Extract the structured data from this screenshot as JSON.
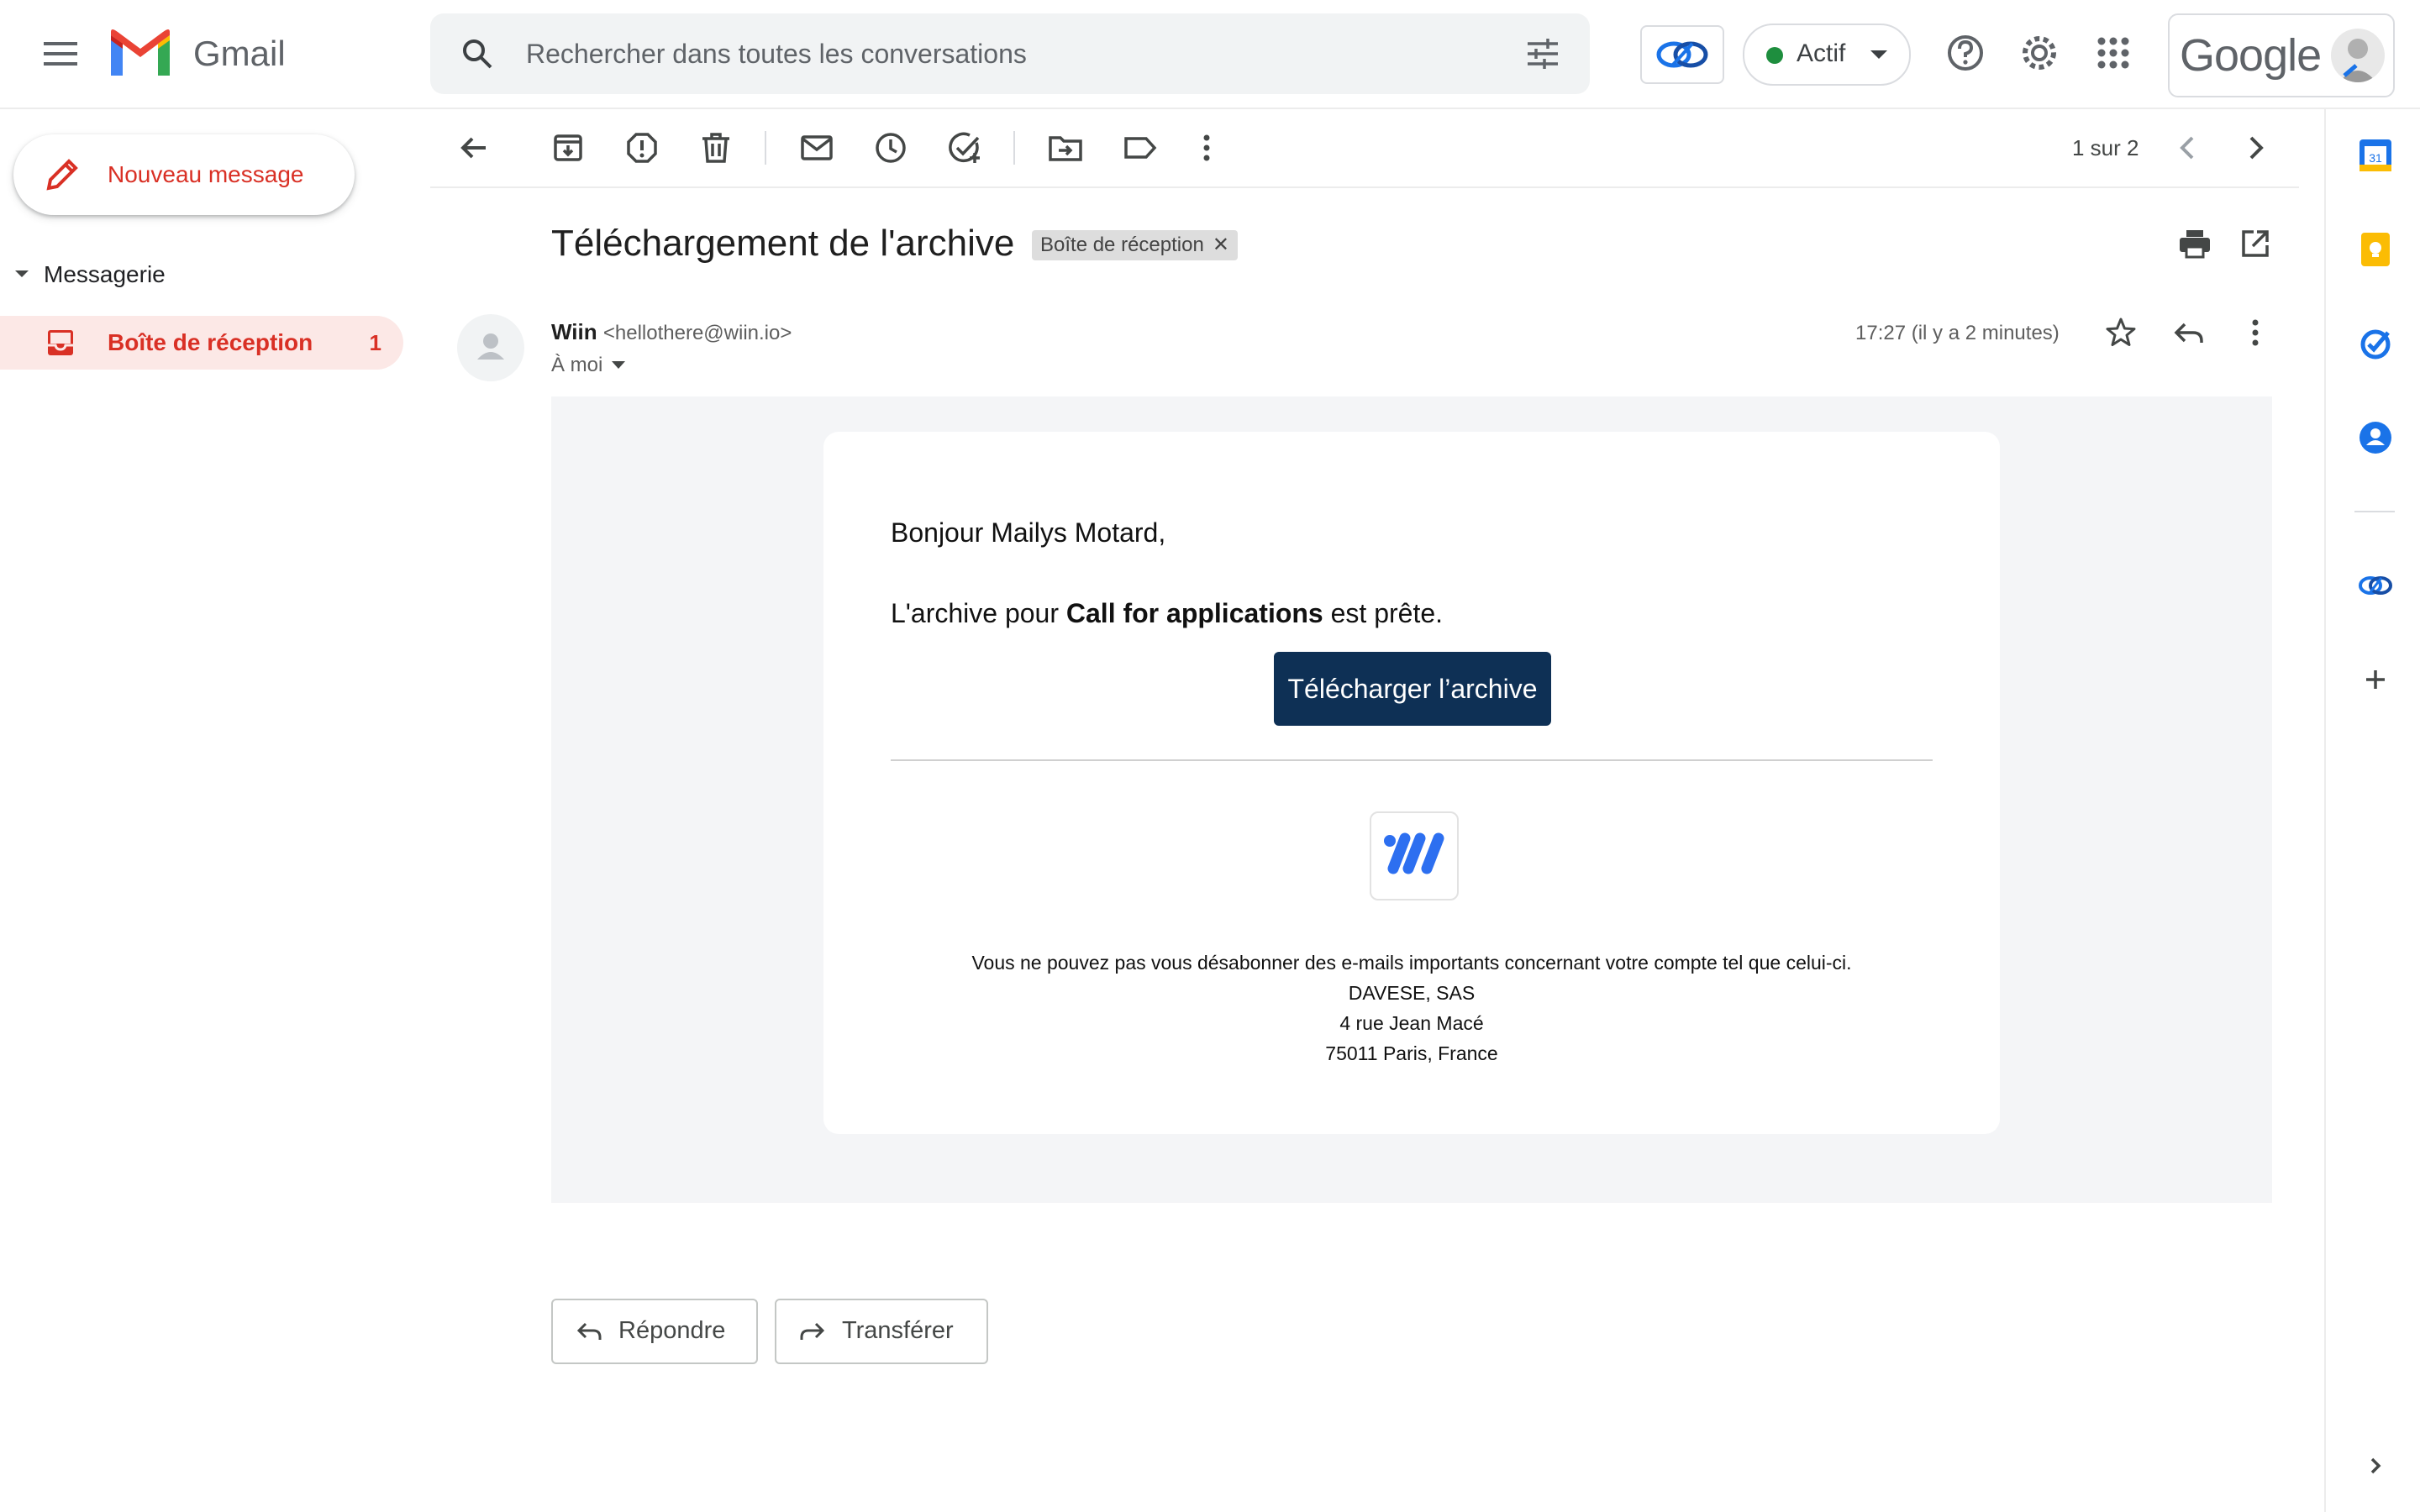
{
  "app": {
    "name": "Gmail",
    "google_label": "Google"
  },
  "search": {
    "placeholder": "Rechercher dans toutes les conversations"
  },
  "status": {
    "label": "Actif",
    "color": "#1e8e3e"
  },
  "compose": {
    "label": "Nouveau message"
  },
  "nav": {
    "section_label": "Messagerie",
    "inbox": {
      "label": "Boîte de réception",
      "count": "1"
    }
  },
  "toolbar": {
    "icons": [
      "back-arrow-icon",
      "archive-icon",
      "report-spam-icon",
      "delete-icon",
      "mark-unread-icon",
      "snooze-icon",
      "add-to-tasks-icon",
      "move-to-icon",
      "label-icon",
      "more-vert-icon"
    ],
    "pager": "1 sur 2"
  },
  "message": {
    "subject": "Téléchargement de l'archive",
    "label_chip": "Boîte de réception",
    "sender_name": "Wiin",
    "sender_email": "<hellothere@wiin.io>",
    "recipient": "À moi",
    "time": "17:27 (il y a 2 minutes)"
  },
  "email_body": {
    "greeting": "Bonjour Mailys Motard,",
    "line_prefix": "L'archive pour ",
    "line_bold": "Call for applications",
    "line_suffix": " est prête.",
    "cta_label": "Télécharger l’archive",
    "cta_color": "#0e3055",
    "footer": [
      "Vous ne pouvez pas vous désabonner des e-mails importants concernant votre compte tel que celui-ci.",
      "DAVESE, SAS",
      "4 rue Jean Macé",
      "75011 Paris, France"
    ]
  },
  "actions": {
    "reply_label": "Répondre",
    "forward_label": "Transférer"
  },
  "accent": {
    "gmail_red": "#d93025",
    "inbox_highlight": "#fce8e6"
  }
}
